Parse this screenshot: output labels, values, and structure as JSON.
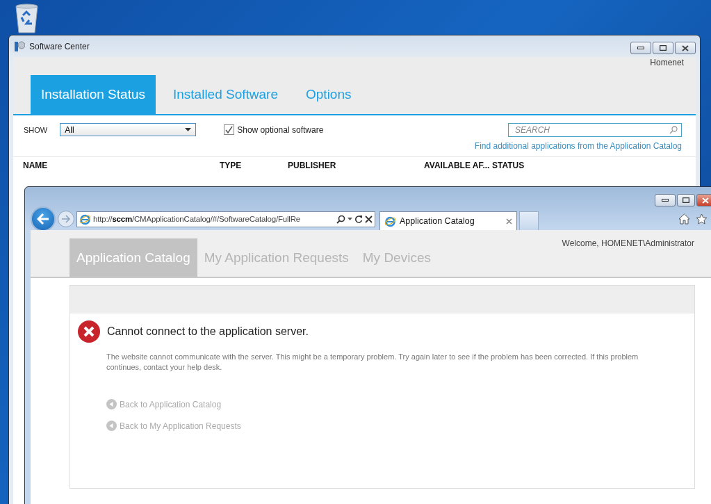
{
  "software_center": {
    "title": "Software Center",
    "user": "Homenet",
    "tabs": [
      {
        "label": "Installation Status",
        "selected": true
      },
      {
        "label": "Installed Software",
        "selected": false
      },
      {
        "label": "Options",
        "selected": false
      }
    ],
    "filter": {
      "label": "SHOW",
      "value": "All"
    },
    "optional_software": {
      "label": "Show optional software",
      "checked": true
    },
    "search": {
      "placeholder": "SEARCH"
    },
    "catalog_link": "Find additional applications from the Application Catalog",
    "columns": [
      "NAME",
      "TYPE",
      "PUBLISHER",
      "AVAILABLE AF...",
      "STATUS"
    ]
  },
  "browser": {
    "address": "http://**sccm**/CMApplicationCatalog/#/SoftwareCatalog/FullRe",
    "tab": {
      "title": "Application Catalog"
    },
    "page": {
      "tabs": [
        {
          "label": "Application Catalog",
          "selected": true
        },
        {
          "label": "My Application Requests",
          "selected": false
        },
        {
          "label": "My Devices",
          "selected": false
        }
      ],
      "welcome": "Welcome, HOMENET\\Administrator",
      "error": {
        "title": "Cannot connect to the application server.",
        "message": "The website cannot communicate with the server. This might be a temporary problem. Try again later to see if the problem has been corrected. If this problem continues, contact your help desk.",
        "links": [
          "Back to Application Catalog",
          "Back to My Application Requests"
        ]
      }
    }
  }
}
